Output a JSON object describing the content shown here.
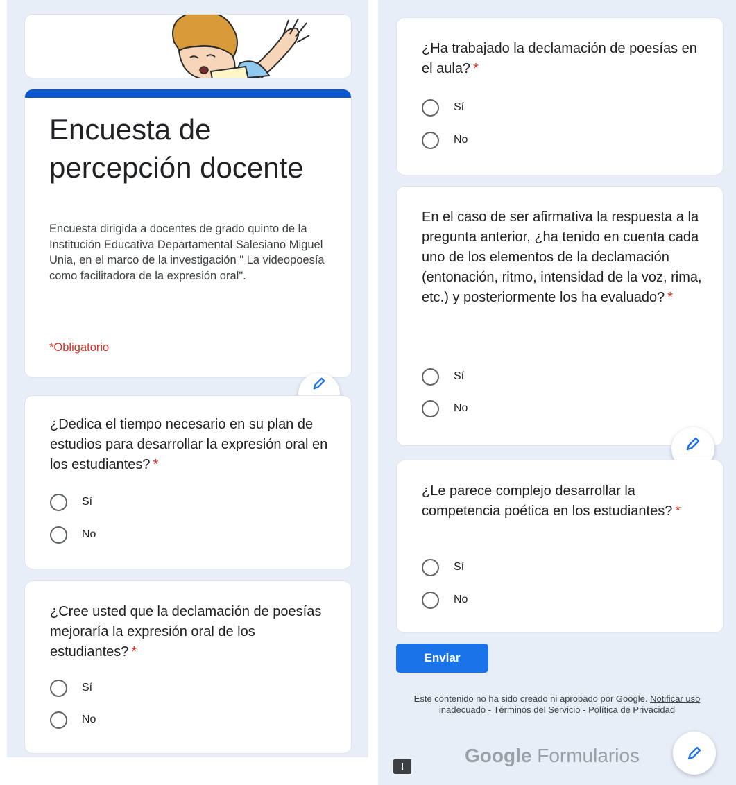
{
  "header": {
    "title": "Encuesta de percepción docente",
    "description": "Encuesta dirigida a docentes de grado quinto de la Institución Educativa Departamental Salesiano Miguel Unia, en el marco de la investigación \" La videopoesía como facilitadora de la expresión oral\".",
    "required_note": "*Obligatorio"
  },
  "questions": [
    {
      "text": "¿Dedica el tiempo necesario en su plan de estudios para desarrollar la expresión oral en los estudiantes?",
      "required_mark": "*",
      "options": [
        "Sí",
        "No"
      ]
    },
    {
      "text": "¿Cree usted que la declamación de poesías mejoraría la expresión oral de los estudiantes?",
      "required_mark": "*",
      "options": [
        "Sí",
        "No"
      ]
    },
    {
      "text": "¿Ha trabajado la declamación de poesías en el aula?",
      "required_mark": "*",
      "options": [
        "Sí",
        "No"
      ]
    },
    {
      "text": "En el caso de ser afirmativa la respuesta a la pregunta anterior, ¿ha tenido en cuenta cada uno de los elementos de la declamación (entonación, ritmo, intensidad de la voz, rima, etc.) y posteriormente los ha evaluado?",
      "required_mark": "*",
      "options": [
        "Sí",
        "No"
      ]
    },
    {
      "text": "¿Le parece complejo desarrollar la competencia poética en los estudiantes?",
      "required_mark": "*",
      "options": [
        "Sí",
        "No"
      ]
    }
  ],
  "submit_label": "Enviar",
  "footer": {
    "disclaimer": "Este contenido no ha sido creado ni aprobado por Google.",
    "link_report": "Notificar uso inadecuado",
    "separator": "-",
    "link_terms": "Términos del Servicio",
    "link_privacy": "Política de Privacidad"
  },
  "brand": {
    "google": "Google",
    "product": "Formularios"
  },
  "icons": {
    "edit": "pencil-icon",
    "report": "report-icon",
    "radio": "radio-unchecked-icon"
  },
  "colors": {
    "accent": "#0b57d0",
    "submit": "#1a73e8",
    "required": "#d93025",
    "background": "#e8eef8"
  }
}
